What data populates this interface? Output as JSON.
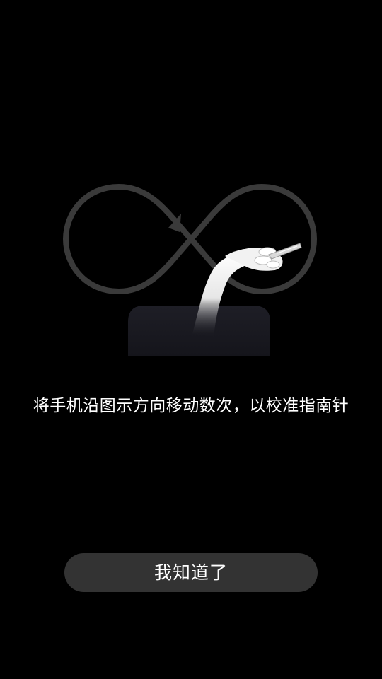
{
  "instruction": {
    "text": "将手机沿图示方向移动数次，以校准指南针"
  },
  "button": {
    "label": "我知道了"
  },
  "illustration": {
    "icons": [
      "figure-eight-path-icon",
      "arrow-icon",
      "hand-holding-phone-icon",
      "surface-block"
    ]
  },
  "colors": {
    "background": "#000000",
    "path": "#3a3a3a",
    "button_bg": "#333333",
    "text": "#ffffff",
    "block": "#1b1b22"
  }
}
